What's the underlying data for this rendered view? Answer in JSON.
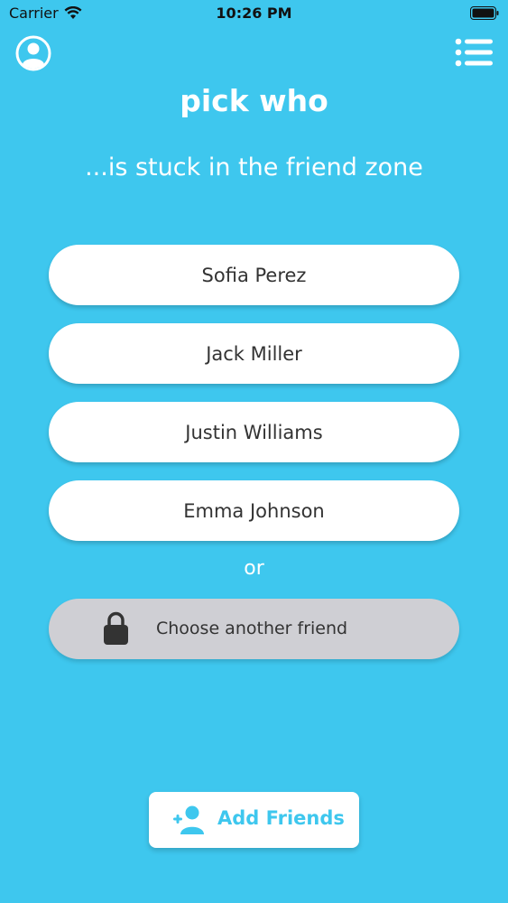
{
  "status_bar": {
    "carrier": "Carrier",
    "time": "10:26 PM"
  },
  "header": {
    "profile_icon": "user-circle-icon",
    "menu_icon": "list-menu-icon"
  },
  "question": {
    "title": "pick who",
    "subtitle": "...is stuck in the friend zone"
  },
  "friends": [
    {
      "name": "Sofia Perez"
    },
    {
      "name": "Jack Miller"
    },
    {
      "name": "Justin Williams"
    },
    {
      "name": "Emma Johnson"
    }
  ],
  "separator": "or",
  "locked_option": {
    "label": "Choose another friend",
    "icon": "lock-icon"
  },
  "add_friends": {
    "label": "Add Friends",
    "icon": "add-user-icon"
  },
  "colors": {
    "background": "#3EC7EE",
    "button": "#FFFFFF",
    "locked_button": "#CFCFD4",
    "text_dark": "#333333"
  }
}
